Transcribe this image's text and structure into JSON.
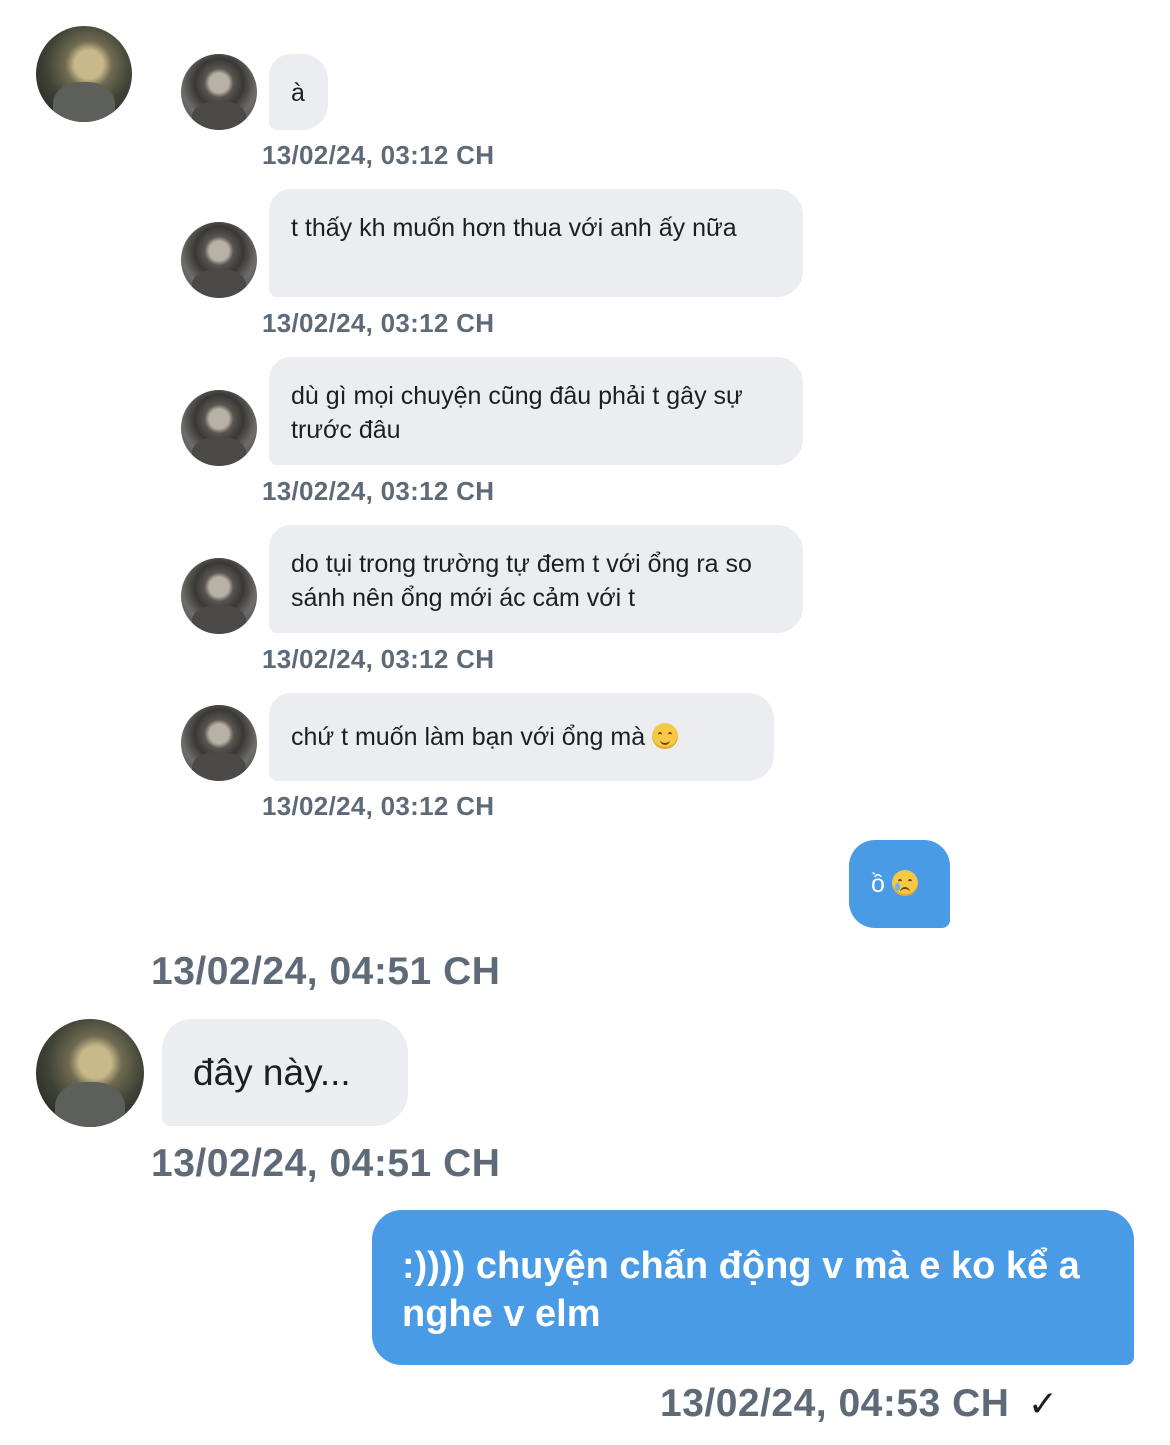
{
  "messages_incoming_small": [
    {
      "text": "à",
      "time": "13/02/24, 03:12 CH"
    },
    {
      "text": "t thấy kh muốn hơn thua với anh ấy nữa",
      "time": "13/02/24, 03:12 CH"
    },
    {
      "text": "dù gì mọi chuyện cũng đâu phải t gây sự trước đâu",
      "time": "13/02/24, 03:12 CH"
    },
    {
      "text": "do tụi trong trường tự đem t với ổng ra so sánh nên ổng mới ác cảm với t",
      "time": "13/02/24, 03:12 CH"
    },
    {
      "text": "chứ t muốn làm bạn với ổng mà",
      "emoji": "smiling-face-icon",
      "time": "13/02/24, 03:12 CH"
    }
  ],
  "outgoing_small": {
    "text": "ồ",
    "emoji": "face-holding-back-tears-icon"
  },
  "separator_time": "13/02/24, 04:51 CH",
  "incoming_large": {
    "text": "đây này...",
    "time": "13/02/24, 04:51 CH"
  },
  "outgoing_large": {
    "text": ":)))) chuyện chấn động v mà e ko kể a nghe v elm",
    "time": "13/02/24, 04:53 CH",
    "status_mark": "✓"
  },
  "colors": {
    "incoming_bubble": "#ebedf1",
    "outgoing_bubble": "#4a9be6",
    "timestamp": "#5f6a78"
  }
}
